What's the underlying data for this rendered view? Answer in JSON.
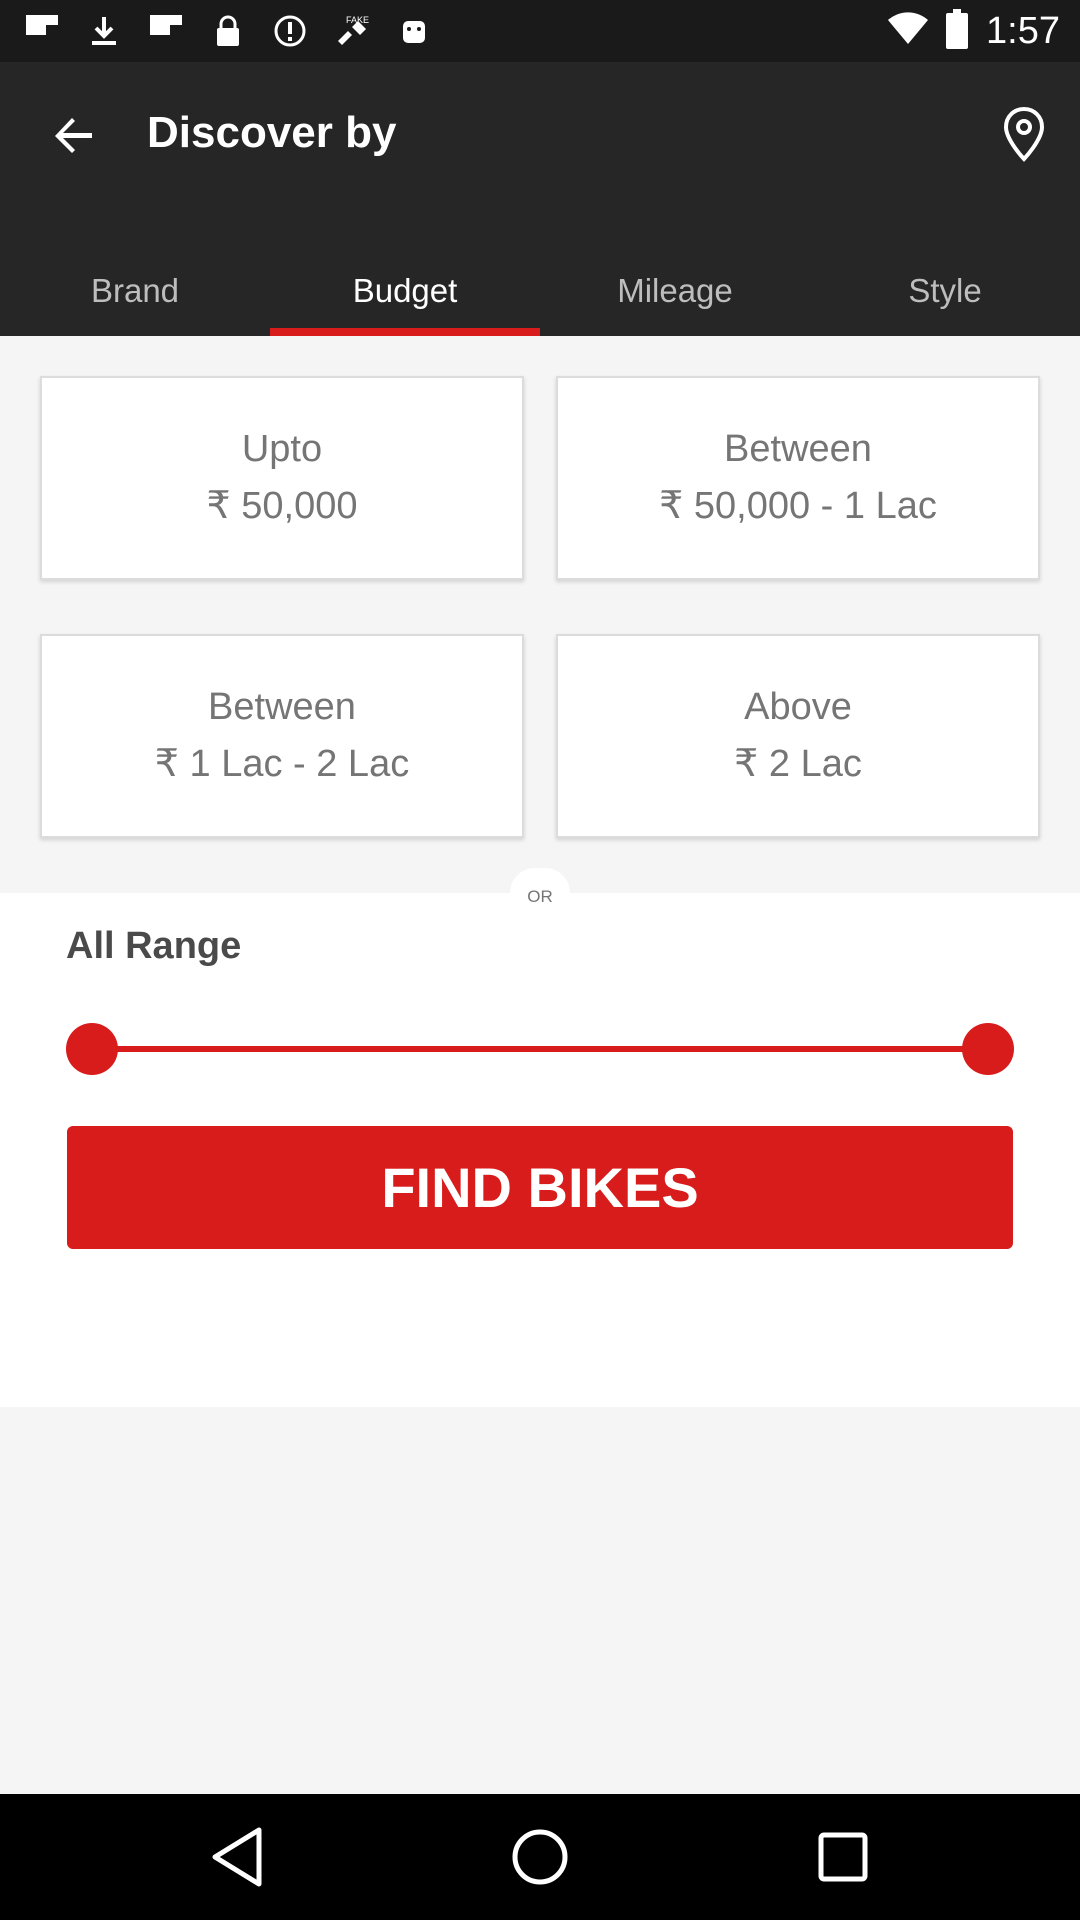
{
  "status_bar": {
    "time": "1:57",
    "icons": [
      "flipboard-icon",
      "download-icon",
      "flipboard-icon",
      "lock-icon",
      "alert-icon",
      "fake-gps-icon",
      "android-icon",
      "wifi-icon",
      "battery-icon"
    ]
  },
  "app_bar": {
    "title": "Discover by",
    "back_icon": "arrow-back-icon",
    "location_icon": "location-pin-icon"
  },
  "tabs": [
    {
      "label": "Brand",
      "active": false
    },
    {
      "label": "Budget",
      "active": true
    },
    {
      "label": "Mileage",
      "active": false
    },
    {
      "label": "Style",
      "active": false
    }
  ],
  "budget_options": [
    {
      "line1": "Upto",
      "line2": "₹ 50,000"
    },
    {
      "line1": "Between",
      "line2": "₹ 50,000 - 1 Lac"
    },
    {
      "line1": "Between",
      "line2": "₹ 1 Lac - 2 Lac"
    },
    {
      "line1": "Above",
      "line2": "₹ 2 Lac"
    }
  ],
  "divider_text": "OR",
  "range": {
    "title": "All Range",
    "min_fraction": 0,
    "max_fraction": 1,
    "button_label": "FIND BIKES"
  },
  "colors": {
    "accent": "#d81b1b",
    "app_bar": "#262626",
    "status_bar": "#1a1a1a"
  }
}
